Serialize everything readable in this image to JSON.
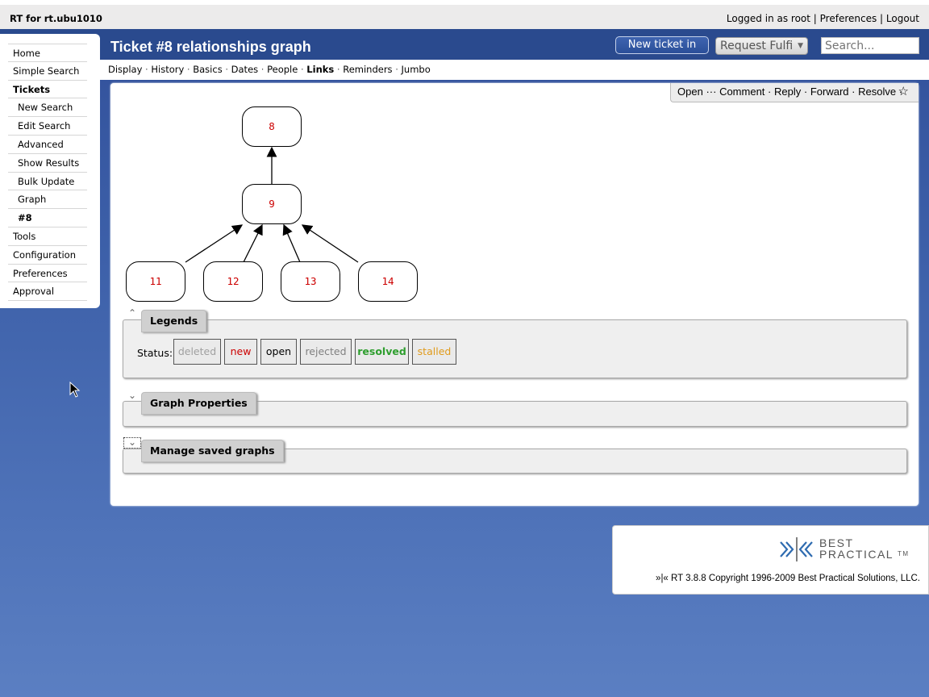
{
  "header": {
    "app_title": "RT for rt.ubu1010",
    "logged_in": "Logged in as root",
    "preferences": "Preferences",
    "logout": "Logout",
    "page_title": "Ticket #8 relationships graph",
    "new_ticket_label": "New ticket in",
    "queue_value": "Request Fulfi",
    "search_placeholder": "Search..."
  },
  "page_menu": {
    "items": [
      "Display",
      "History",
      "Basics",
      "Dates",
      "People",
      "Links",
      "Reminders",
      "Jumbo"
    ],
    "active": "Links"
  },
  "sidebar": {
    "items": [
      {
        "label": "Home"
      },
      {
        "label": "Simple Search"
      },
      {
        "label": "Tickets"
      },
      {
        "label": "New Search"
      },
      {
        "label": "Edit Search"
      },
      {
        "label": "Advanced"
      },
      {
        "label": "Show Results"
      },
      {
        "label": "Bulk Update"
      },
      {
        "label": "Graph"
      },
      {
        "label": "#8"
      },
      {
        "label": "Tools"
      },
      {
        "label": "Configuration"
      },
      {
        "label": "Preferences"
      },
      {
        "label": "Approval"
      }
    ]
  },
  "actions": {
    "open": "Open",
    "dots": "···",
    "comment": "Comment",
    "reply": "Reply",
    "forward": "Forward",
    "resolve": "Resolve",
    "sep": "·",
    "star_icon": "star-icon"
  },
  "graph": {
    "nodes": [
      "8",
      "9",
      "11",
      "12",
      "13",
      "14"
    ],
    "edges": [
      [
        "9",
        "8"
      ],
      [
        "11",
        "9"
      ],
      [
        "12",
        "9"
      ],
      [
        "13",
        "9"
      ],
      [
        "14",
        "9"
      ]
    ]
  },
  "legends": {
    "title": "Legends",
    "status_label": "Status:",
    "statuses": [
      {
        "label": "deleted",
        "color": "#a0a0a0"
      },
      {
        "label": "new",
        "color": "#cc0000"
      },
      {
        "label": "open",
        "color": "#000000"
      },
      {
        "label": "rejected",
        "color": "#808080"
      },
      {
        "label": "resolved",
        "color": "#2e9e2e"
      },
      {
        "label": "stalled",
        "color": "#e09a1a"
      }
    ]
  },
  "graph_properties": {
    "title": "Graph Properties"
  },
  "saved_graphs": {
    "title": "Manage saved graphs"
  },
  "footer": {
    "logo_line1": "BEST",
    "logo_line2": "PRACTICAL",
    "tm": "TM",
    "copyright": "»|« RT 3.8.8 Copyright 1996-2009 Best Practical Solutions, LLC."
  },
  "colors": {
    "header_blue": "#2a4a8e",
    "node_text": "#cc0000",
    "logo_blue": "#2e6bb0"
  }
}
